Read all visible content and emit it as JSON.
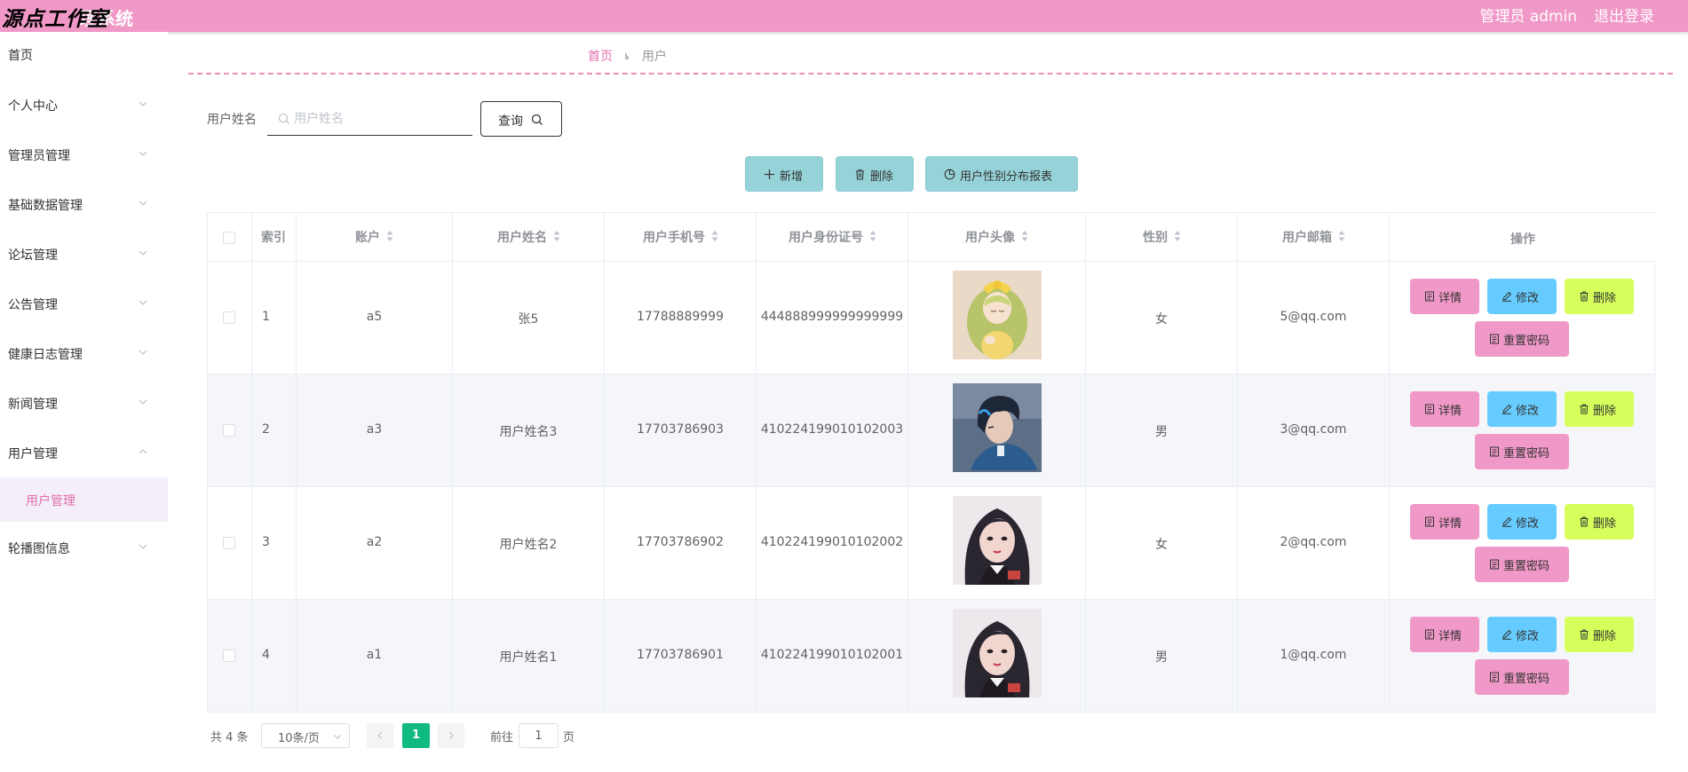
{
  "header": {
    "logo_text": "源点工作室",
    "system_title": "理系统",
    "user_label": "管理员 admin",
    "logout_label": "退出登录"
  },
  "colors": {
    "header_bg": "#f098c7",
    "accent_pink": "#e36fae",
    "action_btn": "#95d3d8",
    "detail_btn": "#f098c7",
    "edit_btn": "#66ccff",
    "delete_btn": "#d6ff5c",
    "pagination_active": "#10b981"
  },
  "sidebar": {
    "items": [
      {
        "label": "首页",
        "has_chevron": false
      },
      {
        "label": "个人中心",
        "has_chevron": true
      },
      {
        "label": "管理员管理",
        "has_chevron": true
      },
      {
        "label": "基础数据管理",
        "has_chevron": true
      },
      {
        "label": "论坛管理",
        "has_chevron": true
      },
      {
        "label": "公告管理",
        "has_chevron": true
      },
      {
        "label": "健康日志管理",
        "has_chevron": true
      },
      {
        "label": "新闻管理",
        "has_chevron": true
      },
      {
        "label": "用户管理",
        "has_chevron": true,
        "expanded": true
      },
      {
        "label": "轮播图信息",
        "has_chevron": true
      }
    ],
    "active_submenu": "用户管理"
  },
  "breadcrumb": {
    "home": "首页",
    "current": "用户"
  },
  "search": {
    "label": "用户姓名",
    "placeholder": "用户姓名",
    "value": "",
    "query_label": "查询"
  },
  "actions": {
    "add_label": "新增",
    "delete_label": "删除",
    "report_label": "用户性别分布报表"
  },
  "table": {
    "headers": {
      "index": "索引",
      "account": "账户",
      "name": "用户姓名",
      "phone": "用户手机号",
      "id_card": "用户身份证号",
      "avatar": "用户头像",
      "gender": "性别",
      "email": "用户邮箱",
      "ops": "操作"
    },
    "rows": [
      {
        "index": "1",
        "account": "a5",
        "name": "张5",
        "phone": "17788889999",
        "id_card": "444888999999999999",
        "avatar": "anime-girl-yellow-bow",
        "gender": "女",
        "email": "5@qq.com"
      },
      {
        "index": "2",
        "account": "a3",
        "name": "用户姓名3",
        "phone": "17703786903",
        "id_card": "410224199010102003",
        "avatar": "anime-boy-blue-hair",
        "gender": "男",
        "email": "3@qq.com"
      },
      {
        "index": "3",
        "account": "a2",
        "name": "用户姓名2",
        "phone": "17703786902",
        "id_card": "410224199010102002",
        "avatar": "girl-portrait-dark-hair",
        "gender": "女",
        "email": "2@qq.com"
      },
      {
        "index": "4",
        "account": "a1",
        "name": "用户姓名1",
        "phone": "17703786901",
        "id_card": "410224199010102001",
        "avatar": "girl-portrait-dark-hair",
        "gender": "男",
        "email": "1@qq.com"
      }
    ],
    "op_labels": {
      "detail": "详情",
      "edit": "修改",
      "delete": "删除",
      "reset": "重置密码"
    }
  },
  "pagination": {
    "total_text": "共 4 条",
    "page_size": "10条/页",
    "current_page": "1",
    "goto_label": "前往",
    "goto_value": "1",
    "page_suffix": "页"
  }
}
